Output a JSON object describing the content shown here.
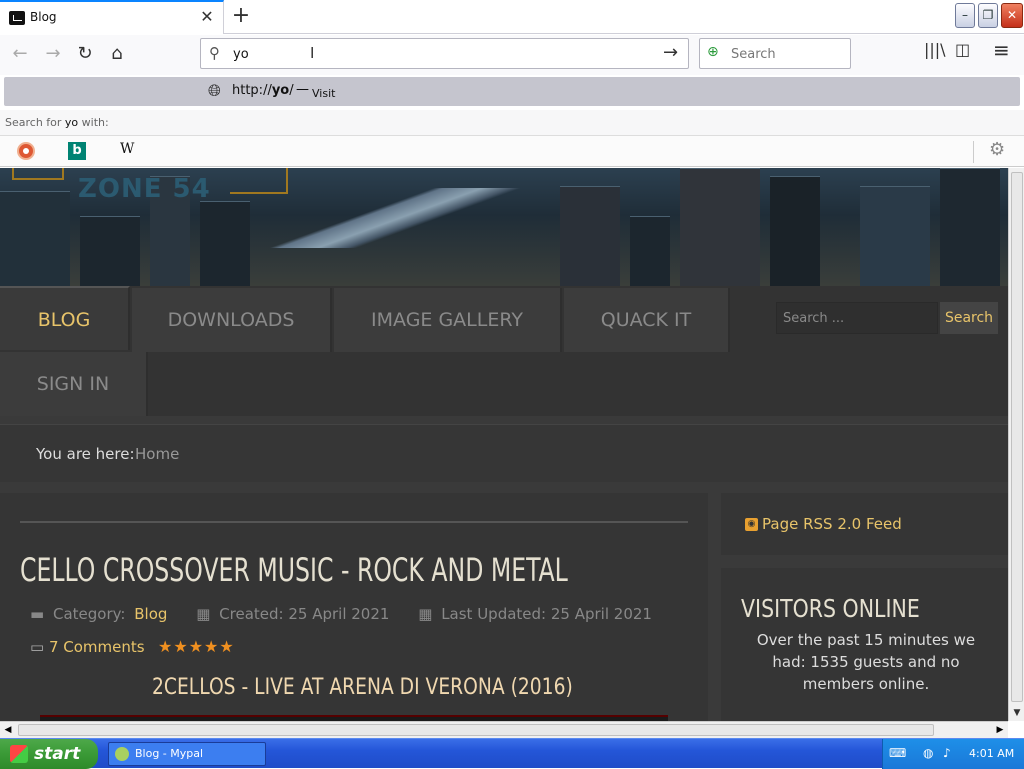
{
  "browser": {
    "tab_title": "Blog",
    "tab_close": "✕",
    "new_tab": "+",
    "url_value": "yo",
    "search_placeholder": "Search",
    "suggestion_prefix": "http://",
    "suggestion_bold": "yo",
    "suggestion_suffix": "/",
    "suggestion_dash": "—",
    "suggestion_action": "Visit",
    "search_for_prefix": "Search for ",
    "search_for_term": "yo",
    "search_for_suffix": " with:",
    "engine_wiki": "W",
    "engine_bing": "b"
  },
  "site": {
    "banner_logo": "ZONE 54",
    "nav": [
      "BLOG",
      "DOWNLOADS",
      "IMAGE GALLERY",
      "QUACK IT",
      "SIGN IN"
    ],
    "search_placeholder": "Search ...",
    "search_button": "Search",
    "breadcrumb_label": "You are here:",
    "breadcrumb_home": "Home"
  },
  "article": {
    "title": "CELLO CROSSOVER MUSIC - ROCK AND METAL",
    "category_label": "Category:",
    "category_value": "Blog",
    "created": "Created: 25 April 2021",
    "updated": "Last Updated: 25 April 2021",
    "comments": "7 Comments",
    "rating": 5,
    "stars": "★★★★★",
    "video_title": "2CELLOS - LIVE AT ARENA DI VERONA (2016)"
  },
  "sidebar": {
    "rss": "Page RSS 2.0 Feed",
    "visitors_title": "VISITORS ONLINE",
    "visitors_text": "Over the past 15 minutes we had: 1535 guests and no members online."
  },
  "taskbar": {
    "start": "start",
    "task": "Blog - Mypal",
    "clock": "4:01 AM"
  },
  "colors": {
    "accent": "#e8c46a",
    "nav_bg": "#3c3c3c",
    "taskbar": "#2456d8"
  }
}
